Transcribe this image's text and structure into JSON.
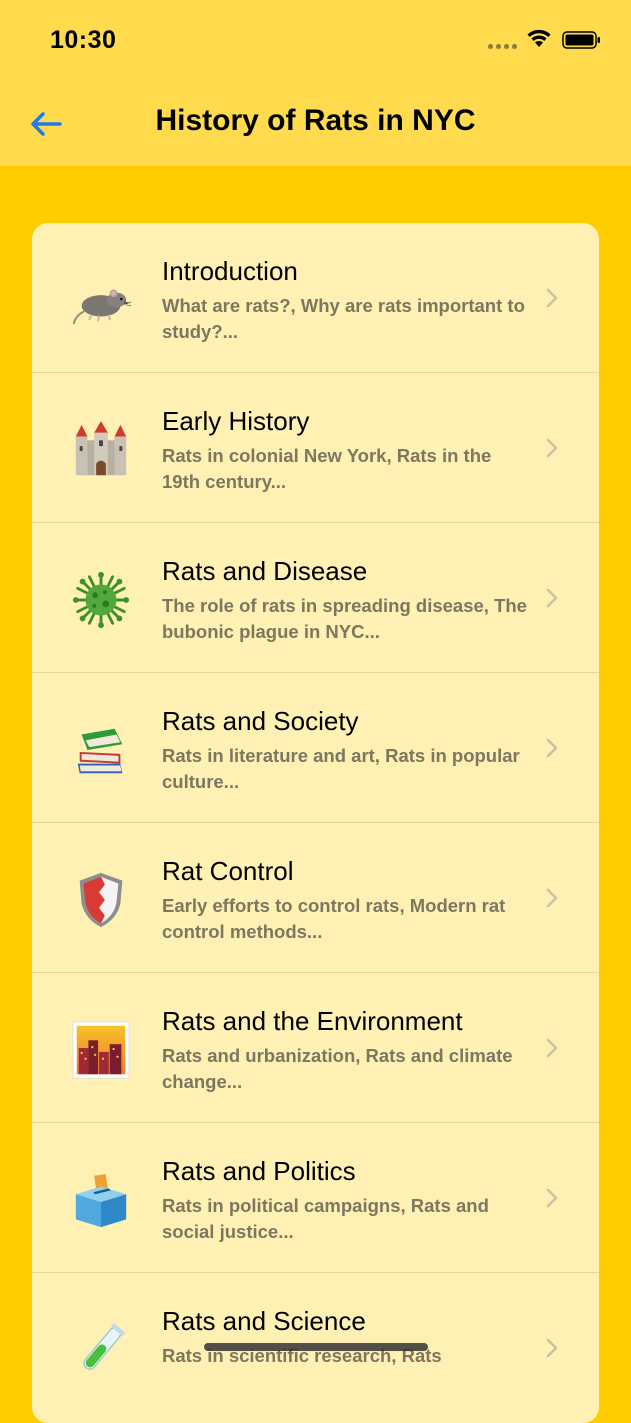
{
  "status_bar": {
    "time": "10:30"
  },
  "nav": {
    "title": "History of Rats in NYC",
    "back_icon": "back-arrow-icon"
  },
  "colors": {
    "background": "#FFCC00",
    "header": "#FFDB4D",
    "card": "#FFF1B3",
    "accent": "#1E7CF2",
    "subtitle": "#7D7760"
  },
  "rows": [
    {
      "icon": "rat-icon",
      "title": "Introduction",
      "subtitle": "What are rats?, Why are rats important to study?..."
    },
    {
      "icon": "castle-icon",
      "title": "Early History",
      "subtitle": "Rats in colonial New York, Rats in the 19th century..."
    },
    {
      "icon": "virus-icon",
      "title": "Rats and Disease",
      "subtitle": "The role of rats in spreading disease, The bubonic plague in NYC..."
    },
    {
      "icon": "books-icon",
      "title": "Rats and Society",
      "subtitle": "Rats in literature and art, Rats in popular culture..."
    },
    {
      "icon": "shield-icon",
      "title": "Rat Control",
      "subtitle": "Early efforts to control rats, Modern rat control methods..."
    },
    {
      "icon": "cityscape-icon",
      "title": "Rats and the Environment",
      "subtitle": "Rats and urbanization, Rats and climate change..."
    },
    {
      "icon": "ballot-box-icon",
      "title": "Rats and Politics",
      "subtitle": "Rats in political campaigns, Rats and social justice..."
    },
    {
      "icon": "test-tube-icon",
      "title": "Rats and Science",
      "subtitle": "Rats in scientific research, Rats"
    }
  ]
}
